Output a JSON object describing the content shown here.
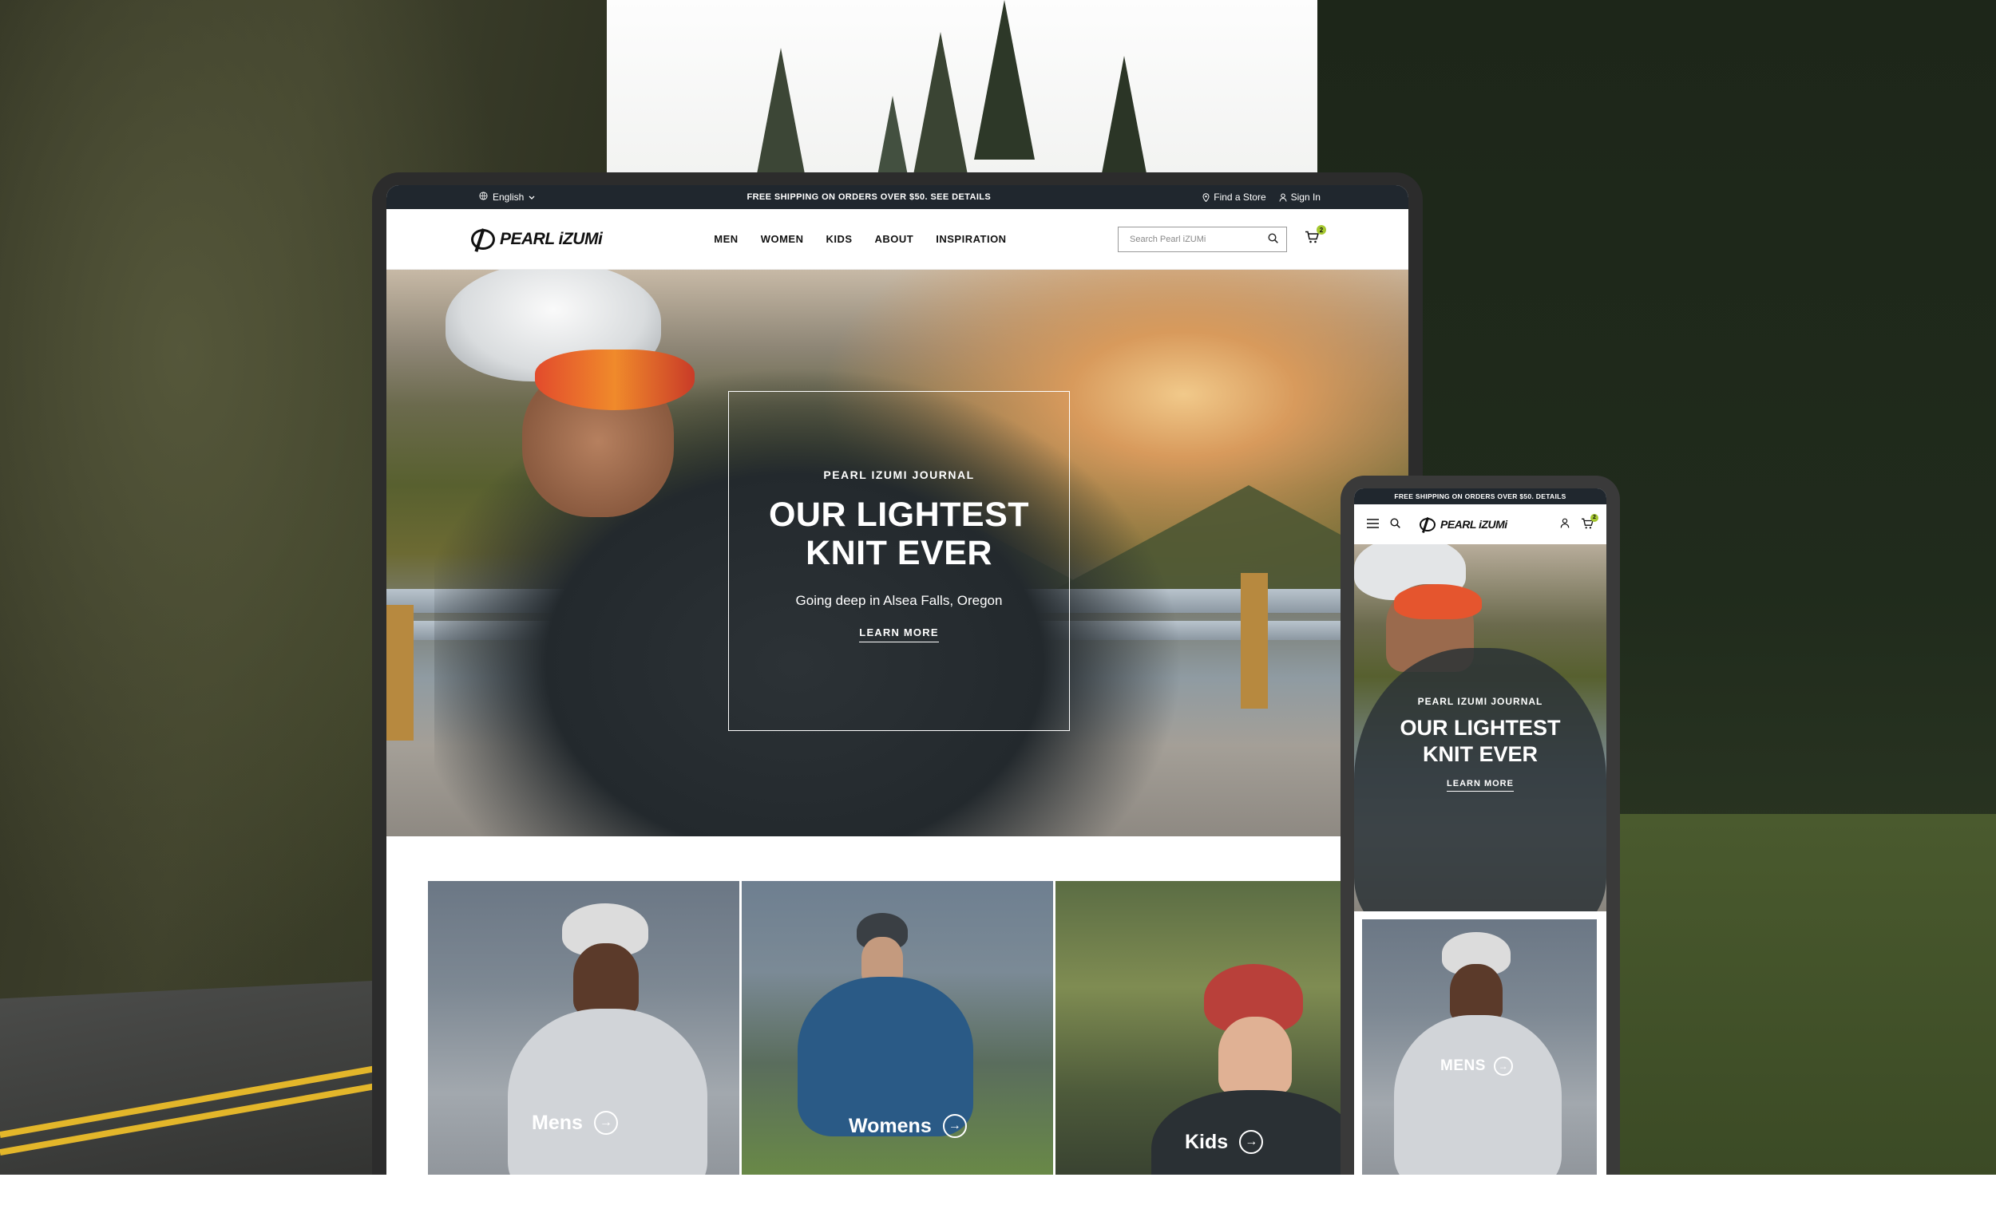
{
  "desktop": {
    "topbar": {
      "language": "English",
      "promo": "FREE SHIPPING ON ORDERS OVER $50. SEE DETAILS",
      "find_store": "Find a Store",
      "sign_in": "Sign In"
    },
    "brand": "PEARL iZUMi",
    "menu": [
      "MEN",
      "WOMEN",
      "KIDS",
      "ABOUT",
      "INSPIRATION"
    ],
    "search_placeholder": "Search Pearl iZUMi",
    "cart_count": "2",
    "hero": {
      "eyebrow": "PEARL IZUMI JOURNAL",
      "headline": "OUR LIGHTEST KNIT EVER",
      "subtitle": "Going deep in Alsea Falls, Oregon",
      "cta": "LEARN MORE"
    },
    "tiles": [
      {
        "label": "Mens"
      },
      {
        "label": "Womens"
      },
      {
        "label": "Kids"
      }
    ]
  },
  "mobile": {
    "promo": "FREE SHIPPING ON ORDERS OVER $50. DETAILS",
    "brand": "PEARL iZUMi",
    "cart_count": "2",
    "hero": {
      "eyebrow": "PEARL IZUMI JOURNAL",
      "headline": "OUR LIGHTEST KNIT EVER",
      "cta": "LEARN MORE"
    },
    "tile": {
      "label": "MENS"
    }
  },
  "colors": {
    "topbar_bg": "#20272e",
    "cart_badge": "#a6c830",
    "device_frame": "#2c2c2c"
  },
  "icons": [
    "globe-icon",
    "chevron-down-icon",
    "location-pin-icon",
    "user-icon",
    "search-icon",
    "cart-icon",
    "arrow-right-circle-icon",
    "hamburger-menu-icon"
  ]
}
